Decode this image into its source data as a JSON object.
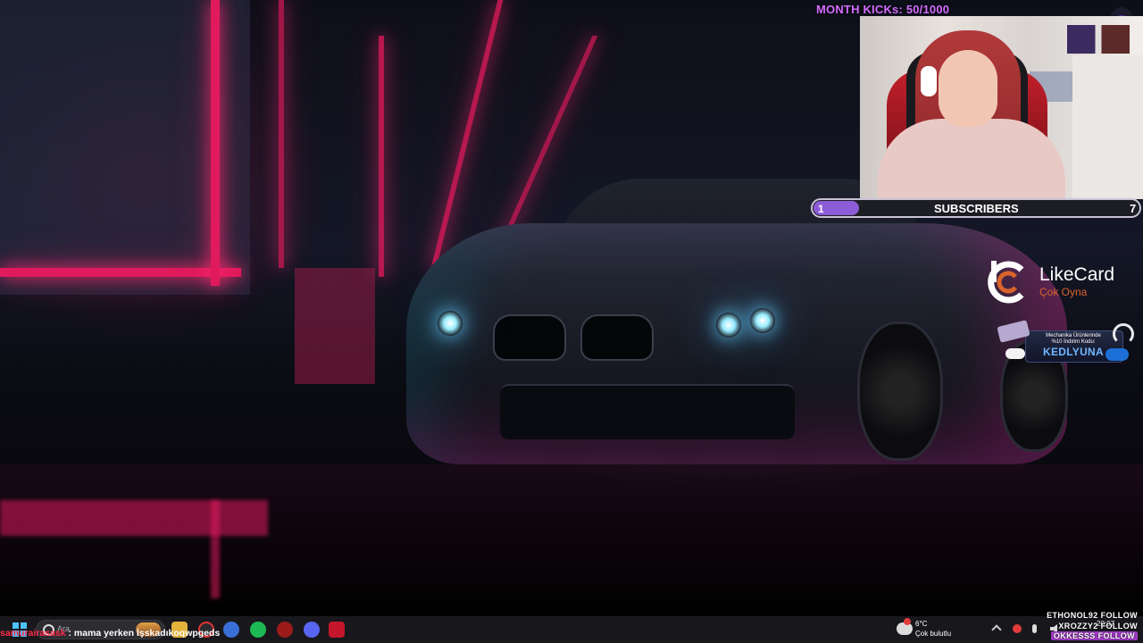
{
  "overlay": {
    "month_kicks": "MONTH KICKs: 50/1000"
  },
  "subscribers": {
    "current": "1",
    "label": "SUBSCRIBERS",
    "goal": "7",
    "progress_fraction": 0.14
  },
  "sponsor": {
    "brand": "LikeCard",
    "tagline": "Çok Oyna"
  },
  "promo": {
    "line1": "Mechanika Ürünlerinde",
    "line2": "%10 İndirim Kodu:",
    "code": "KEDLYUNA"
  },
  "chat": {
    "user": "samurairasask",
    "message": ": mama yerken İşskadıkoqwpgeds"
  },
  "taskbar": {
    "search_placeholder": "Ara",
    "weather_temp": "6°C",
    "weather_desc": "Çok bulutlu",
    "time": "20:07"
  },
  "follows": [
    {
      "text": "ETHONOL92 FOLLOW",
      "highlight": false
    },
    {
      "text": "XROZZY2 FOLLOW",
      "highlight": false
    },
    {
      "text": "OKKESSS FOLLOW",
      "highlight": true
    }
  ],
  "colors": {
    "neon": "#e01a5c",
    "accent_purple": "#8c5cd8",
    "month_kicks": "#d46bff",
    "chat_user": "#ff2d4a"
  }
}
